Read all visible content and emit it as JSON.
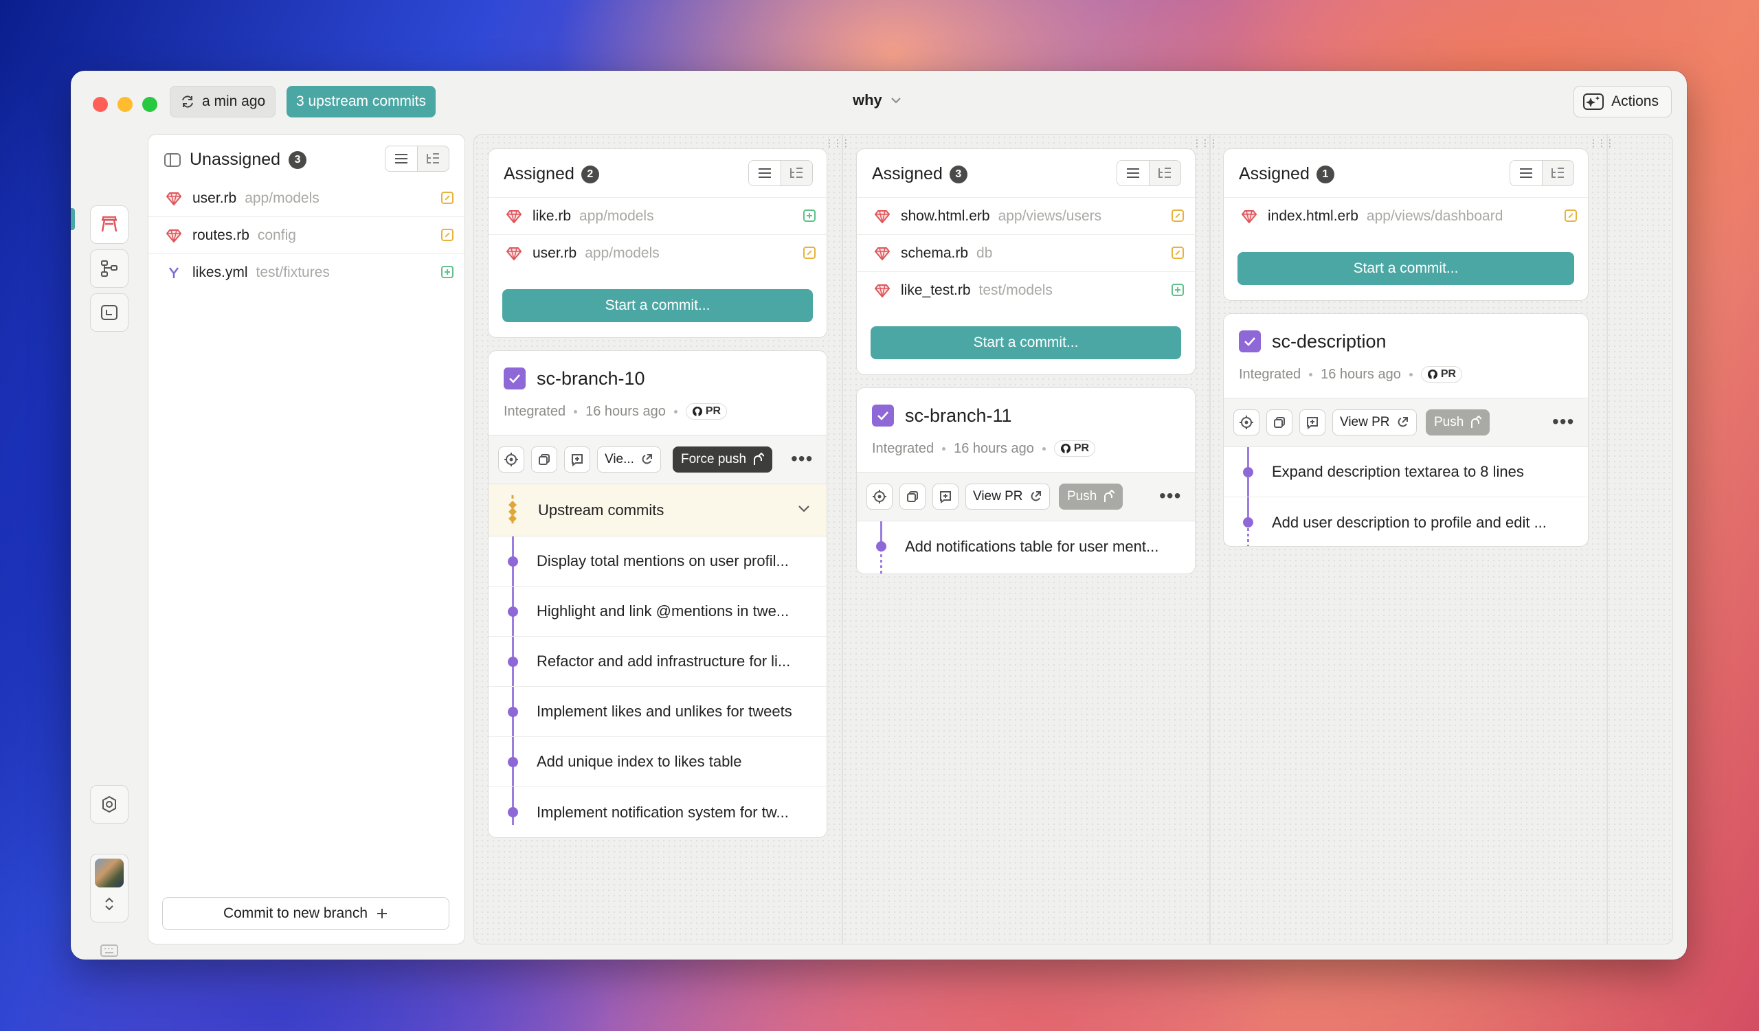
{
  "titlebar": {
    "last_fetch": "a min ago",
    "upstream_label": "3 upstream commits",
    "project_name": "why",
    "actions_label": "Actions"
  },
  "unassigned": {
    "title": "Unassigned",
    "count": "3",
    "files": [
      {
        "name": "user.rb",
        "path": "app/models",
        "status": "modified"
      },
      {
        "name": "routes.rb",
        "path": "config",
        "status": "modified"
      },
      {
        "name": "likes.yml",
        "path": "test/fixtures",
        "status": "added"
      }
    ],
    "commit_new_label": "Commit to new branch"
  },
  "lanes": [
    {
      "assigned_title": "Assigned",
      "assigned_count": "2",
      "files": [
        {
          "name": "like.rb",
          "path": "app/models",
          "status": "added"
        },
        {
          "name": "user.rb",
          "path": "app/models",
          "status": "modified"
        }
      ],
      "start_commit_label": "Start a commit...",
      "branch": {
        "name": "sc-branch-10",
        "status": "Integrated",
        "time": "16 hours ago",
        "pr": "PR",
        "view_pr_label": "Vie...",
        "push_label": "Force push",
        "upstream_label": "Upstream commits",
        "commits": [
          "Display total mentions on user profil...",
          "Highlight and link @mentions in twe...",
          "Refactor and add infrastructure for li...",
          "Implement likes and unlikes for tweets",
          "Add unique index to likes table",
          "Implement notification system for tw..."
        ]
      }
    },
    {
      "assigned_title": "Assigned",
      "assigned_count": "3",
      "files": [
        {
          "name": "show.html.erb",
          "path": "app/views/users",
          "status": "modified"
        },
        {
          "name": "schema.rb",
          "path": "db",
          "status": "modified"
        },
        {
          "name": "like_test.rb",
          "path": "test/models",
          "status": "added"
        }
      ],
      "start_commit_label": "Start a commit...",
      "branch": {
        "name": "sc-branch-11",
        "status": "Integrated",
        "time": "16 hours ago",
        "pr": "PR",
        "view_pr_label": "View PR",
        "push_label": "Push",
        "commits": [
          "Add notifications table for user ment..."
        ]
      }
    },
    {
      "assigned_title": "Assigned",
      "assigned_count": "1",
      "files": [
        {
          "name": "index.html.erb",
          "path": "app/views/dashboard",
          "status": "modified"
        }
      ],
      "start_commit_label": "Start a commit...",
      "branch": {
        "name": "sc-description",
        "status": "Integrated",
        "time": "16 hours ago",
        "pr": "PR",
        "view_pr_label": "View PR",
        "push_label": "Push",
        "commits": [
          "Expand description textarea to 8 lines",
          "Add user description to profile and edit ..."
        ]
      }
    }
  ],
  "colors": {
    "accent_teal": "#4ba7a4",
    "branch_purple": "#8f68d8",
    "upstream_amber": "#e0a63a",
    "ruby_red": "#e0555a"
  },
  "icons": {
    "workspace": "workbench-icon",
    "branches": "branches-icon",
    "history": "history-icon",
    "settings": "settings-icon",
    "keyboard": "keyboard-icon",
    "mail": "mail-icon"
  }
}
